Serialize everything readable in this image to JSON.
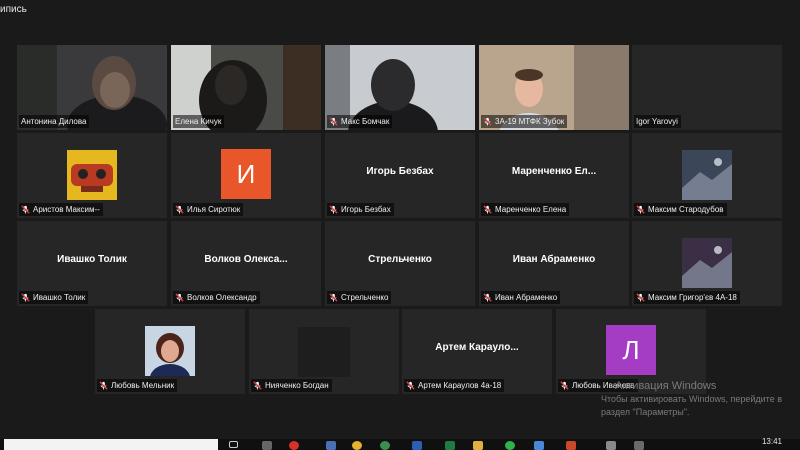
{
  "window": {
    "top_label": "ипись"
  },
  "participants": [
    {
      "tag": "Антонина Дилова",
      "muted": false,
      "big": "",
      "kind": "video",
      "active": true,
      "bg": "#3a3a3c"
    },
    {
      "tag": "Елена Кичук",
      "muted": false,
      "big": "",
      "kind": "video",
      "bg": "#4a4a46"
    },
    {
      "tag": "Макс Бомчак",
      "muted": true,
      "big": "",
      "kind": "video",
      "bg": "#8e9096"
    },
    {
      "tag": "3А-19 МТФК Зубок",
      "muted": true,
      "big": "",
      "kind": "video",
      "bg": "#7e6f62"
    },
    {
      "tag": "Igor Yarovyi",
      "muted": false,
      "big": "",
      "kind": "blank",
      "bg": "#262626"
    },
    {
      "tag": "Аристов Максим--",
      "muted": true,
      "big": "",
      "kind": "cartoon",
      "bg": "#262626"
    },
    {
      "tag": "Илья Сиротюк",
      "muted": true,
      "big": "",
      "kind": "letter",
      "letter": "И",
      "color": "#e8562a"
    },
    {
      "tag": "Игорь Безбах",
      "muted": true,
      "big": "Игорь Безбах",
      "kind": "name"
    },
    {
      "tag": "Маренченко Елена",
      "muted": true,
      "big": "Маренченко  Ел...",
      "kind": "name"
    },
    {
      "tag": "Максим Стародубов",
      "muted": true,
      "big": "",
      "kind": "photo",
      "color": "#3b4658"
    },
    {
      "tag": "Ивашко Толик",
      "muted": true,
      "big": "Ивашко Толик",
      "kind": "name"
    },
    {
      "tag": "Волков Олександр",
      "muted": true,
      "big": "Волков  Олекса...",
      "kind": "name"
    },
    {
      "tag": "Стрельченко",
      "muted": true,
      "big": "Стрельченко",
      "kind": "name"
    },
    {
      "tag": "Иван Абраменко",
      "muted": true,
      "big": "Иван Абраменко",
      "kind": "name"
    },
    {
      "tag": "Максим Григор'єв 4А-18",
      "muted": true,
      "big": "",
      "kind": "photo",
      "color": "#3a2f44"
    },
    {
      "tag": "Любовь Мельник",
      "muted": true,
      "big": "",
      "kind": "portrait"
    },
    {
      "tag": "Нияченко Богдан",
      "muted": true,
      "big": "",
      "kind": "slide"
    },
    {
      "tag": "Артем Караулов 4а-18",
      "muted": true,
      "big": "Артем  Караулo...",
      "kind": "name"
    },
    {
      "tag": "Любовь Иванова",
      "muted": true,
      "big": "",
      "kind": "letter",
      "letter": "Л",
      "color": "#a43cc4"
    }
  ],
  "watermark": {
    "line1": "Активация Windows",
    "line2": "Чтобы активировать Windows, перейдите в",
    "line3": "раздел \"Параметры\"."
  },
  "taskbar": {
    "clock": "13:41"
  },
  "colors": {
    "active_border": "#d4d94a",
    "mic_muted": "#e04141",
    "tile_bg": "#262626",
    "page_bg": "#1a1a1a"
  }
}
